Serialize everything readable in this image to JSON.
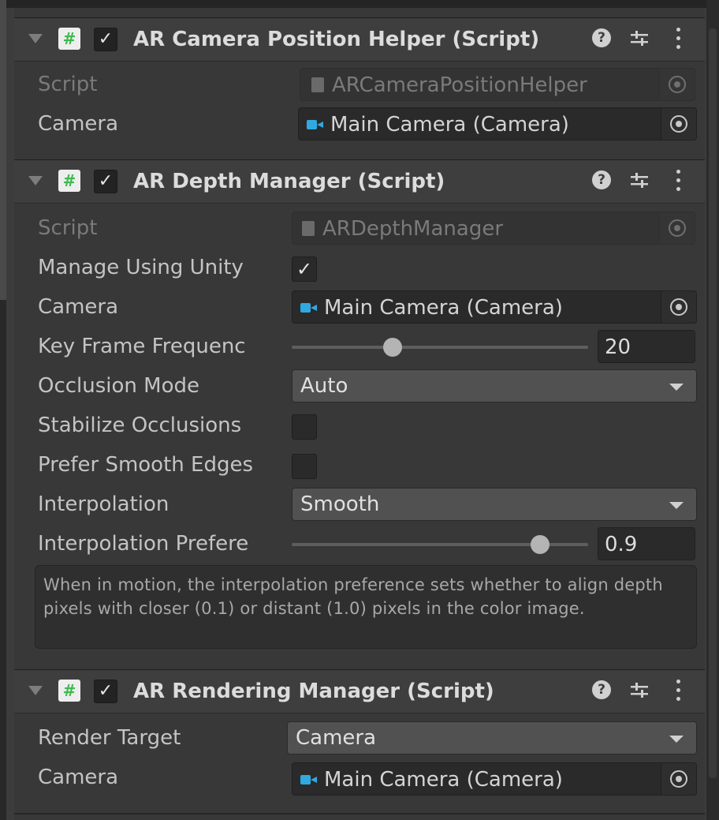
{
  "components": [
    {
      "title": "AR Camera Position Helper (Script)",
      "enabled": true,
      "fields": {
        "script_label": "Script",
        "script_value": "ARCameraPositionHelper",
        "camera_label": "Camera",
        "camera_value": "Main Camera (Camera)"
      }
    },
    {
      "title": "AR Depth Manager (Script)",
      "enabled": true,
      "fields": {
        "script_label": "Script",
        "script_value": "ARDepthManager",
        "manage_label": "Manage Using Unity",
        "manage_checked": true,
        "camera_label": "Camera",
        "camera_value": "Main Camera (Camera)",
        "keyframe_label": "Key Frame Frequenc",
        "keyframe_value": "20",
        "keyframe_fraction": 0.33,
        "occlusion_label": "Occlusion Mode",
        "occlusion_value": "Auto",
        "stabilize_label": "Stabilize Occlusions",
        "stabilize_checked": false,
        "smooth_edges_label": "Prefer Smooth Edges",
        "smooth_edges_checked": false,
        "interpolation_label": "Interpolation",
        "interpolation_value": "Smooth",
        "interp_pref_label": "Interpolation Prefere",
        "interp_pref_value": "0.9",
        "interp_pref_fraction": 0.86,
        "help_text": "When in motion, the interpolation preference sets whether to align depth pixels with closer (0.1) or distant (1.0) pixels in the color image."
      }
    },
    {
      "title": "AR Rendering Manager (Script)",
      "enabled": true,
      "fields": {
        "render_target_label": "Render Target",
        "render_target_value": "Camera",
        "camera_label": "Camera",
        "camera_value": "Main Camera (Camera)"
      }
    }
  ],
  "header_icons": [
    "help-icon",
    "preset-icon",
    "more-menu-icon"
  ],
  "colors": {
    "panel_bg": "#383838",
    "header_bg": "#3e3e3e",
    "field_bg": "#2a2a2a",
    "dropdown_bg": "#515151",
    "script_hash_green": "#3fb950",
    "camera_icon_blue": "#31a9e0"
  }
}
